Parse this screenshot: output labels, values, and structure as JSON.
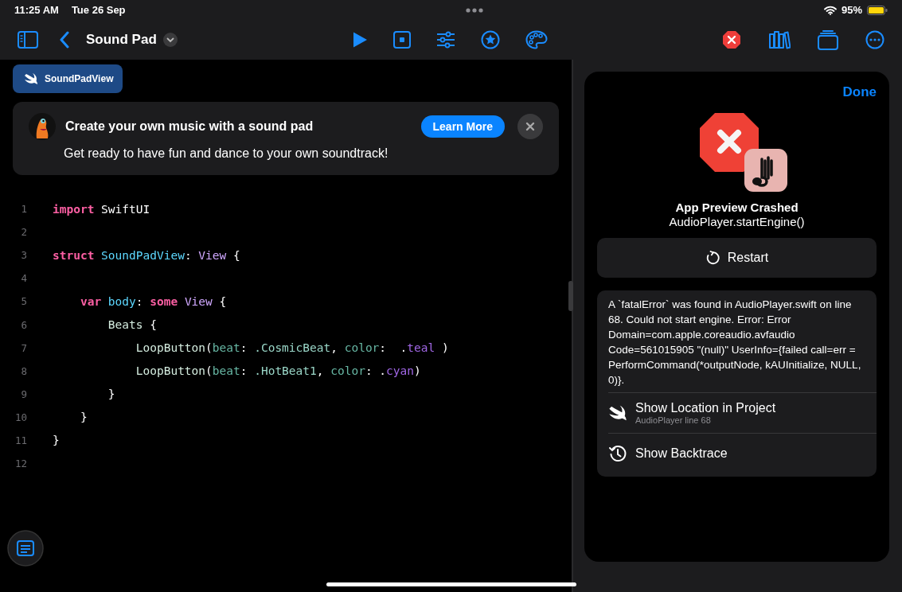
{
  "status_bar": {
    "time": "11:25 AM",
    "date": "Tue 26 Sep",
    "battery": "95%"
  },
  "toolbar": {
    "title": "Sound Pad"
  },
  "file_tab": {
    "label": "SoundPadView",
    "selected": true
  },
  "banner": {
    "title": "Create your own music with a sound pad",
    "subtitle": "Get ready to have fun and dance to your own soundtrack!",
    "button": "Learn More"
  },
  "code_lines": [
    {
      "number": "1",
      "tokens": [
        {
          "kind": "keyword",
          "text": "import"
        },
        {
          "kind": "plain",
          "text": " SwiftUI"
        }
      ]
    },
    {
      "number": "2"
    },
    {
      "number": "3",
      "tokens": [
        {
          "kind": "keyword",
          "text": "struct"
        },
        {
          "kind": "decl",
          "text": " SoundPadView"
        },
        {
          "kind": "plain",
          "text": ": "
        },
        {
          "kind": "type",
          "text": "View"
        },
        {
          "kind": "plain",
          "text": " {"
        }
      ]
    },
    {
      "number": "4"
    },
    {
      "number": "5",
      "tokens": [
        {
          "kind": "keyword",
          "text": "    var"
        },
        {
          "kind": "decl",
          "text": " body"
        },
        {
          "kind": "plain",
          "text": ": "
        },
        {
          "kind": "keyword",
          "text": "some"
        },
        {
          "kind": "type",
          "text": " View"
        },
        {
          "kind": "plain",
          "text": " {"
        }
      ]
    },
    {
      "number": "6",
      "tokens": [
        {
          "kind": "func",
          "text": "        Beats"
        },
        {
          "kind": "plain",
          "text": " {"
        }
      ]
    },
    {
      "number": "7",
      "tokens": [
        {
          "kind": "func",
          "text": "            LoopButton"
        },
        {
          "kind": "plain",
          "text": "("
        },
        {
          "kind": "param",
          "text": "beat"
        },
        {
          "kind": "plain",
          "text": ": "
        },
        {
          "kind": "member",
          "text": ".CosmicBeat"
        },
        {
          "kind": "plain",
          "text": ", "
        },
        {
          "kind": "param",
          "text": "color"
        },
        {
          "kind": "plain",
          "text": ":  ."
        },
        {
          "kind": "value",
          "text": "teal"
        },
        {
          "kind": "plain",
          "text": " )"
        }
      ]
    },
    {
      "number": "8",
      "tokens": [
        {
          "kind": "func",
          "text": "            LoopButton"
        },
        {
          "kind": "plain",
          "text": "("
        },
        {
          "kind": "param",
          "text": "beat"
        },
        {
          "kind": "plain",
          "text": ": "
        },
        {
          "kind": "member",
          "text": ".HotBeat1"
        },
        {
          "kind": "plain",
          "text": ", "
        },
        {
          "kind": "param",
          "text": "color"
        },
        {
          "kind": "plain",
          "text": ": ."
        },
        {
          "kind": "value",
          "text": "cyan"
        },
        {
          "kind": "plain",
          "text": ")"
        }
      ]
    },
    {
      "number": "9",
      "tokens": [
        {
          "kind": "plain",
          "text": "        }"
        }
      ]
    },
    {
      "number": "10",
      "tokens": [
        {
          "kind": "plain",
          "text": "    }"
        }
      ]
    },
    {
      "number": "11",
      "tokens": [
        {
          "kind": "plain",
          "text": "}"
        }
      ]
    },
    {
      "number": "12"
    }
  ],
  "crash_panel": {
    "done": "Done",
    "title": "App Preview Crashed",
    "subtitle": "AudioPlayer.startEngine()",
    "restart": "Restart",
    "message": "A `fatalError` was found in AudioPlayer.swift on line 68. Could not start engine. Error: Error Domain=com.apple.coreaudio.avfaudio Code=561015905 \"(null)\" UserInfo={failed call=err = PerformCommand(*outputNode, kAUInitialize, NULL, 0)}.",
    "actions": [
      {
        "kind": "location",
        "label": "Show Location in Project",
        "detail": "AudioPlayer line 68"
      },
      {
        "kind": "backtrace",
        "label": "Show Backtrace"
      }
    ]
  }
}
